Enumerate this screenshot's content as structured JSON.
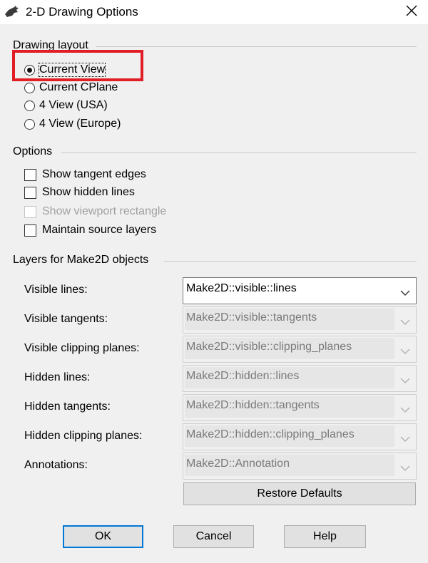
{
  "window": {
    "title": "2-D Drawing Options",
    "close_icon": "close-icon",
    "app_icon": "rhino-icon"
  },
  "drawing_layout": {
    "label": "Drawing layout",
    "options": [
      {
        "label": "Current View",
        "selected": true
      },
      {
        "label": "Current CPlane",
        "selected": false
      },
      {
        "label": "4 View (USA)",
        "selected": false
      },
      {
        "label": "4 View (Europe)",
        "selected": false
      }
    ]
  },
  "options": {
    "label": "Options",
    "items": [
      {
        "label": "Show tangent edges",
        "checked": false,
        "enabled": true
      },
      {
        "label": "Show hidden lines",
        "checked": false,
        "enabled": true
      },
      {
        "label": "Show viewport rectangle",
        "checked": false,
        "enabled": false
      },
      {
        "label": "Maintain source layers",
        "checked": false,
        "enabled": true
      }
    ]
  },
  "layers": {
    "label": "Layers for Make2D objects",
    "rows": [
      {
        "label": "Visible lines:",
        "value": "Make2D::visible::lines",
        "enabled": true
      },
      {
        "label": "Visible tangents:",
        "value": "Make2D::visible::tangents",
        "enabled": false
      },
      {
        "label": "Visible clipping planes:",
        "value": "Make2D::visible::clipping_planes",
        "enabled": false
      },
      {
        "label": "Hidden lines:",
        "value": "Make2D::hidden::lines",
        "enabled": false
      },
      {
        "label": "Hidden tangents:",
        "value": "Make2D::hidden::tangents",
        "enabled": false
      },
      {
        "label": "Hidden clipping planes:",
        "value": "Make2D::hidden::clipping_planes",
        "enabled": false
      },
      {
        "label": "Annotations:",
        "value": "Make2D::Annotation",
        "enabled": false
      }
    ],
    "restore_label": "Restore Defaults"
  },
  "buttons": {
    "ok": "OK",
    "cancel": "Cancel",
    "help": "Help"
  },
  "colors": {
    "highlight": "#e11e26",
    "default_button_border": "#0078d7"
  }
}
